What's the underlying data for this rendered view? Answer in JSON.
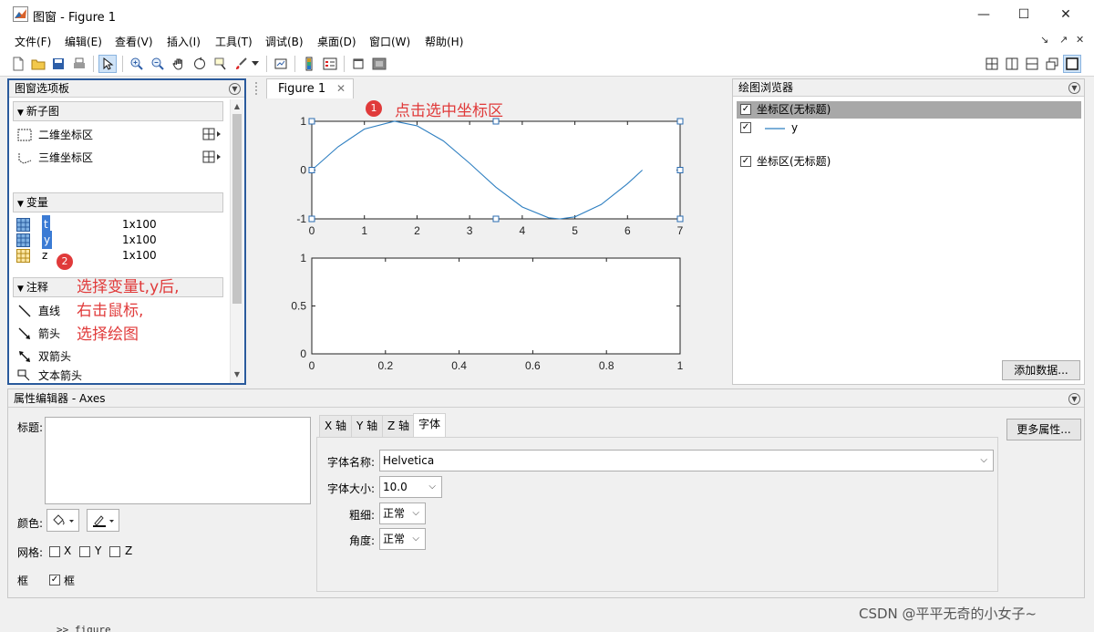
{
  "window": {
    "title": "图窗 - Figure 1",
    "controls": {
      "minimize": "—",
      "maximize": "☐",
      "close": "✕"
    }
  },
  "menu": {
    "items": [
      "文件(F)",
      "编辑(E)",
      "查看(V)",
      "插入(I)",
      "工具(T)",
      "调试(B)",
      "桌面(D)",
      "窗口(W)",
      "帮助(H)"
    ],
    "right_controls": [
      "↘",
      "↗",
      "✕"
    ]
  },
  "palette": {
    "title": "图窗选项板",
    "sections": {
      "new_subplot": "新子图",
      "variables": "变量",
      "annotations": "注释"
    },
    "subplot_items": [
      "二维坐标区",
      "三维坐标区"
    ],
    "variables": [
      {
        "name": "t",
        "size": "1x100",
        "selected": true
      },
      {
        "name": "y",
        "size": "1x100",
        "selected": true
      },
      {
        "name": "z",
        "size": "1x100",
        "selected": false
      }
    ],
    "annotation_items": [
      "直线",
      "箭头",
      "双箭头",
      "文本箭头"
    ]
  },
  "figure": {
    "tab_label": "Figure 1",
    "tab_close": "✕"
  },
  "chart_data": [
    {
      "type": "line",
      "title": "",
      "xlabel": "",
      "ylabel": "",
      "xlim": [
        0,
        7
      ],
      "ylim": [
        -1,
        1
      ],
      "x_ticks": [
        "0",
        "1",
        "2",
        "3",
        "4",
        "5",
        "6",
        "7"
      ],
      "y_ticks": [
        "1",
        "0",
        "-1"
      ],
      "series": [
        {
          "name": "y",
          "color": "#2e7fc1",
          "x": [
            0,
            0.5,
            1,
            1.5708,
            2,
            2.5,
            3,
            3.1416,
            3.5,
            4,
            4.5,
            4.7124,
            5,
            5.5,
            6,
            6.2832
          ],
          "y": [
            0,
            0.479,
            0.841,
            1,
            0.909,
            0.598,
            0.141,
            0,
            -0.351,
            -0.757,
            -0.978,
            -1,
            -0.959,
            -0.706,
            -0.279,
            0
          ]
        }
      ]
    },
    {
      "type": "line",
      "title": "",
      "xlabel": "",
      "ylabel": "",
      "xlim": [
        0,
        1
      ],
      "ylim": [
        0,
        1
      ],
      "x_ticks": [
        "0",
        "0.2",
        "0.4",
        "0.6",
        "0.8",
        "1"
      ],
      "y_ticks": [
        "1",
        "0.5",
        "0"
      ],
      "series": []
    }
  ],
  "browser": {
    "title": "绘图浏览器",
    "rows": [
      {
        "label": "坐标区(无标题)",
        "checked": true,
        "selected": true
      },
      {
        "label": "y",
        "checked": true,
        "selected": false
      },
      {
        "label": "坐标区(无标题)",
        "checked": true,
        "selected": false
      }
    ],
    "add_data_button": "添加数据..."
  },
  "property_editor": {
    "title": "属性编辑器 - Axes",
    "title_label": "标题:",
    "color_label": "颜色:",
    "grid_label": "网格:",
    "grid_options": [
      "X",
      "Y",
      "Z"
    ],
    "box_label": "框",
    "box_option": "框",
    "tabs": [
      "X 轴",
      "Y 轴",
      "Z 轴",
      "字体"
    ],
    "font_name_label": "字体名称:",
    "font_name_value": "Helvetica",
    "font_size_label": "字体大小:",
    "font_size_value": "10.0",
    "weight_label": "粗细:",
    "weight_value": "正常",
    "angle_label": "角度:",
    "angle_value": "正常",
    "more_button": "更多属性..."
  },
  "annotations": {
    "step1_badge": "1",
    "step1_text": "点击选中坐标区",
    "step2_badge": "2",
    "step2_line1": "选择变量t,y后,",
    "step2_line2": "右击鼠标,",
    "step2_line3": "选择绘图"
  },
  "footer": {
    "command": ">> figure",
    "watermark": "CSDN @平平无奇的小女子~"
  },
  "colors": {
    "accent": "#2a5a9c",
    "annotation": "#e03a3a",
    "line": "#2e7fc1",
    "selected_row": "#a8a8a8"
  }
}
